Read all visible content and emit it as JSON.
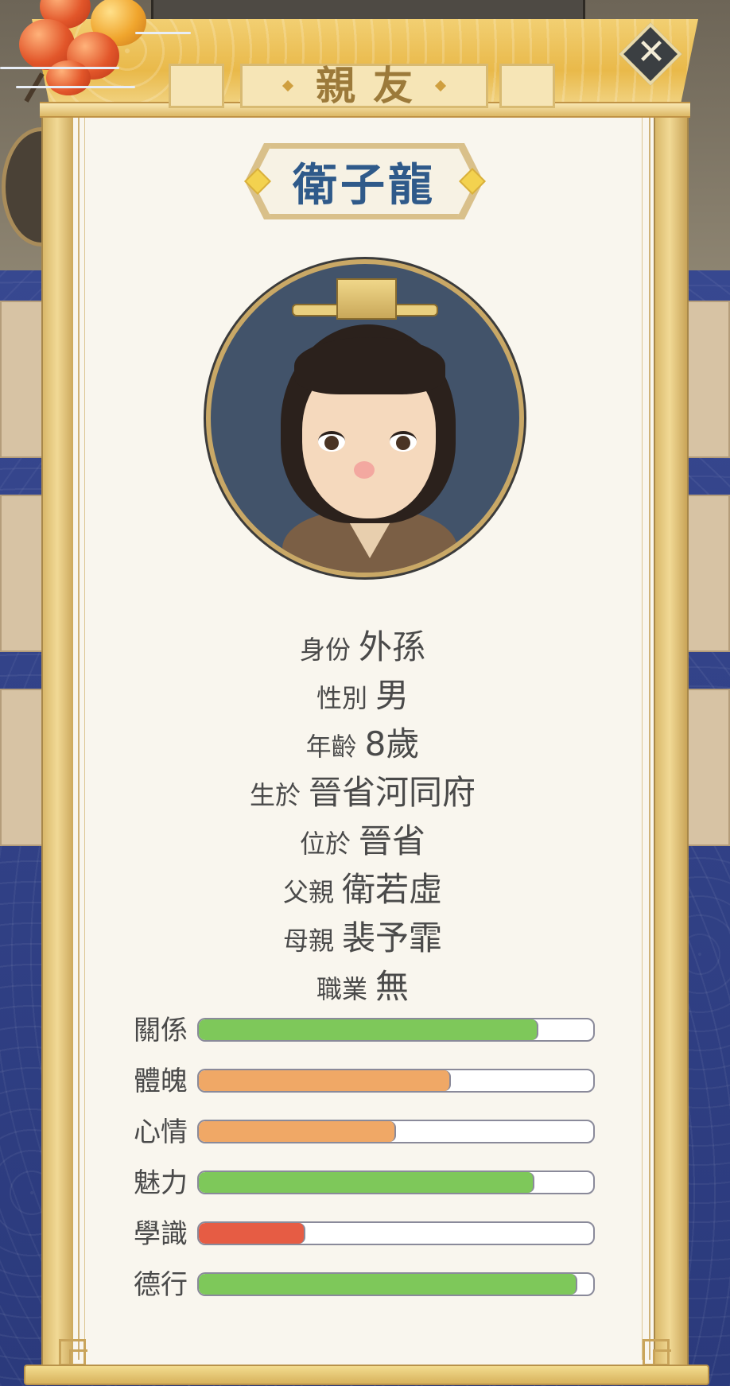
{
  "header": {
    "title": "親友"
  },
  "profile": {
    "name": "衛子龍"
  },
  "info": [
    {
      "key": "身份",
      "value": "外孫"
    },
    {
      "key": "性別",
      "value": "男"
    },
    {
      "key": "年齡",
      "value": "8歲"
    },
    {
      "key": "生於",
      "value": "晉省河同府"
    },
    {
      "key": "位於",
      "value": "晉省"
    },
    {
      "key": "父親",
      "value": "衛若虛"
    },
    {
      "key": "母親",
      "value": "裴予霏"
    },
    {
      "key": "職業",
      "value": "無"
    }
  ],
  "stats": [
    {
      "label": "關係",
      "level": 0.86,
      "color": "#7ec85a"
    },
    {
      "label": "體魄",
      "level": 0.64,
      "color": "#f0a866"
    },
    {
      "label": "心情",
      "level": 0.5,
      "color": "#f0a866"
    },
    {
      "label": "魅力",
      "level": 0.85,
      "color": "#7ec85a"
    },
    {
      "label": "學識",
      "level": 0.27,
      "color": "#e65c44"
    },
    {
      "label": "德行",
      "level": 0.96,
      "color": "#7ec85a"
    }
  ],
  "icons": {
    "close": "close-icon"
  }
}
